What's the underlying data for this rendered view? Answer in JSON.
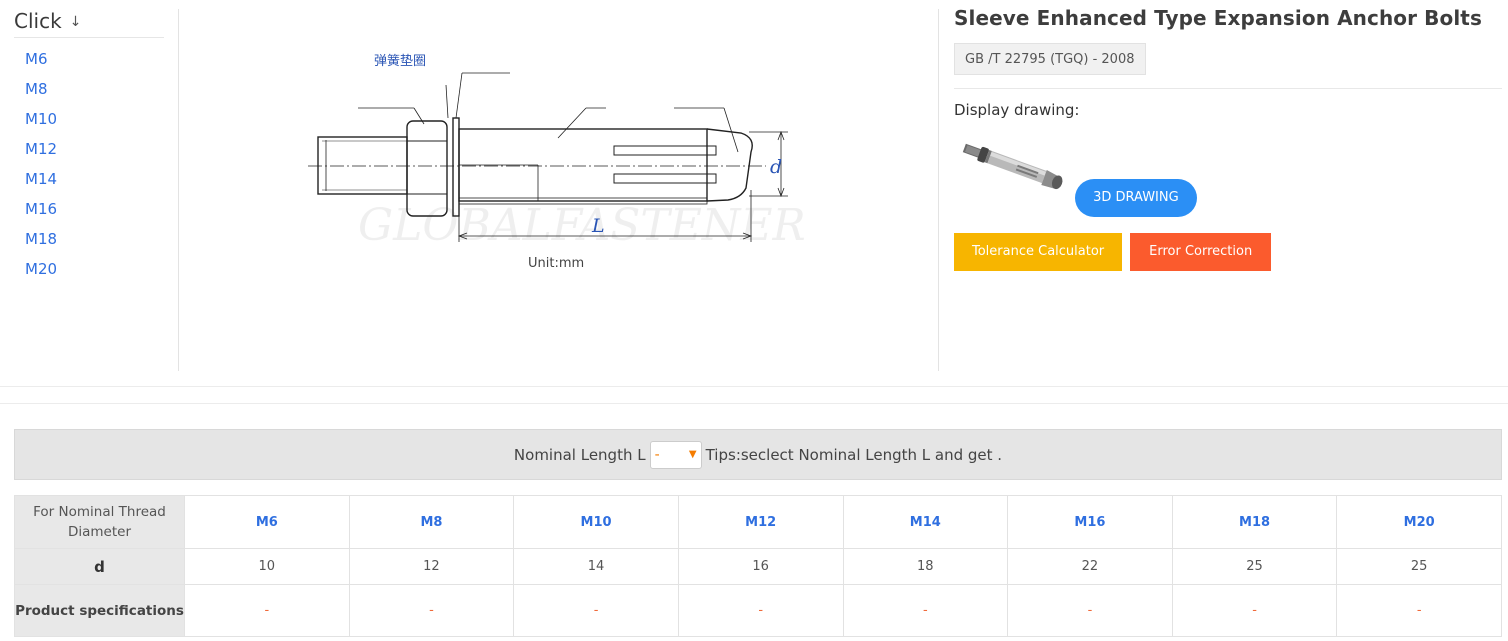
{
  "sidebar": {
    "title": "Click",
    "arrow": "↓",
    "sizes": [
      "M6",
      "M8",
      "M10",
      "M12",
      "M14",
      "M16",
      "M18",
      "M20"
    ]
  },
  "drawing": {
    "washer_label": "弹簧垫圈",
    "dim_d": "d",
    "dim_L": "L",
    "watermark": "GLOBALFASTENER",
    "unit": "Unit:mm"
  },
  "product": {
    "title": "Sleeve Enhanced Type Expansion Anchor Bolts",
    "standard": "GB /T 22795 (TGQ) - 2008",
    "display_label": "Display drawing:",
    "btn_3d": "3D DRAWING",
    "btn_tolerance": "Tolerance Calculator",
    "btn_error": "Error Correction"
  },
  "nominal": {
    "label": "Nominal Length L",
    "selected": "-",
    "tips": "Tips:seclect Nominal Length L and get ."
  },
  "table": {
    "header_label": "For Nominal Thread Diameter",
    "columns": [
      "M6",
      "M8",
      "M10",
      "M12",
      "M14",
      "M16",
      "M18",
      "M20"
    ],
    "rows": [
      {
        "label": "d",
        "values": [
          "10",
          "12",
          "14",
          "16",
          "18",
          "22",
          "25",
          "25"
        ]
      },
      {
        "label": "Product specifications",
        "values": [
          "-",
          "-",
          "-",
          "-",
          "-",
          "-",
          "-",
          "-"
        ]
      }
    ]
  },
  "colors": {
    "link_blue": "#2f6fe0",
    "btn_3d": "#2b8ff5",
    "btn_tolerance": "#f7b500",
    "btn_error": "#fb5b2d",
    "dash_orange": "#f06a3a"
  }
}
